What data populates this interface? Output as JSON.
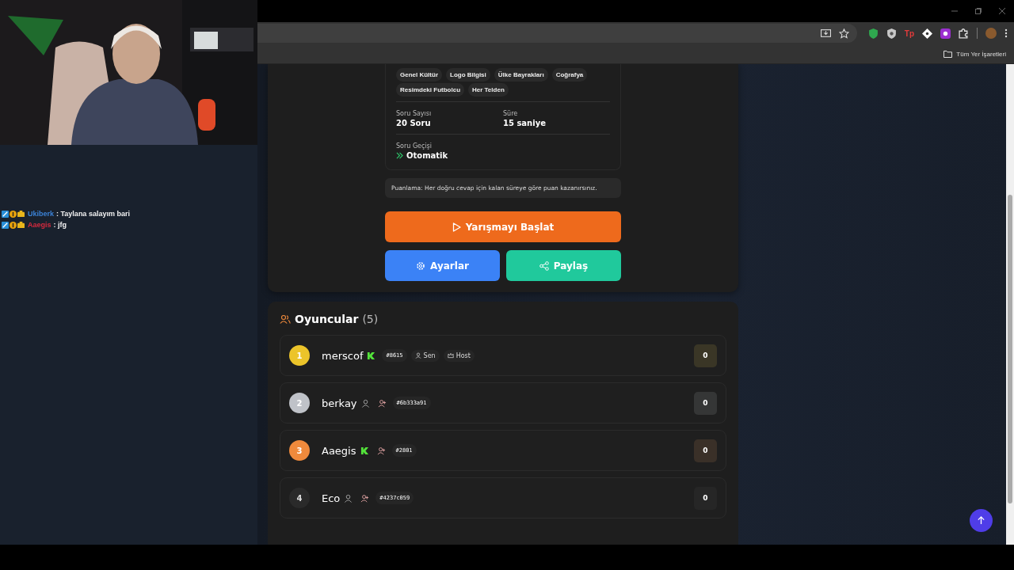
{
  "chat": {
    "messages": [
      {
        "user": "Ukiberk",
        "color": "#3b82d6",
        "text": ": Taylana salayım bari"
      },
      {
        "user": "Aaegis",
        "color": "#d42a3e",
        "text": ": jfg"
      }
    ]
  },
  "browser": {
    "extensions": [
      {
        "kind": "green-shield"
      },
      {
        "kind": "grey-shield"
      },
      {
        "kind": "text",
        "label": "Tp"
      },
      {
        "kind": "diamond"
      },
      {
        "kind": "purple-app"
      },
      {
        "kind": "puzzle"
      }
    ],
    "bookmarks_bar": {
      "all_bookmarks": "Tüm Yer İşaretleri"
    }
  },
  "quiz": {
    "categories": [
      "Genel Kültür",
      "Logo Bilgisi",
      "Ülke Bayrakları",
      "Coğrafya",
      "Resimdeki Futbolcu",
      "Her Telden"
    ],
    "stats": [
      {
        "label": "Soru Sayısı",
        "value": "20 Soru"
      },
      {
        "label": "Süre",
        "value": "15 saniye"
      }
    ],
    "transition": {
      "label": "Soru Geçişi",
      "value": "Otomatik"
    },
    "scoring_note": "Puanlama: Her doğru cevap için kalan süreye göre puan kazanırsınız.",
    "start_button": "Yarışmayı Başlat",
    "settings_button": "Ayarlar",
    "share_button": "Paylaş"
  },
  "players": {
    "title": "Oyuncular",
    "count": "(5)",
    "rows": [
      {
        "rank": "1",
        "color": "#ecc42a",
        "name": "merscof",
        "verified": true,
        "guest": false,
        "add_friend": false,
        "tag": "#8615",
        "badges": [
          {
            "kind": "you",
            "label": "Sen"
          },
          {
            "kind": "host",
            "label": "Host"
          }
        ],
        "score": "0"
      },
      {
        "rank": "2",
        "color": "#bfc2c8",
        "name": "berkay",
        "verified": false,
        "guest": true,
        "add_friend": true,
        "tag": "#6b333a91",
        "badges": [],
        "score": "0"
      },
      {
        "rank": "3",
        "color": "#f08a3c",
        "name": "Aaegis",
        "verified": true,
        "guest": false,
        "add_friend": true,
        "tag": "#2801",
        "badges": [],
        "score": "0"
      },
      {
        "rank": "4",
        "color": "#2a2a2a",
        "name": "Eco",
        "verified": false,
        "guest": true,
        "add_friend": true,
        "tag": "#4237c059",
        "badges": [],
        "score": "0"
      }
    ]
  }
}
